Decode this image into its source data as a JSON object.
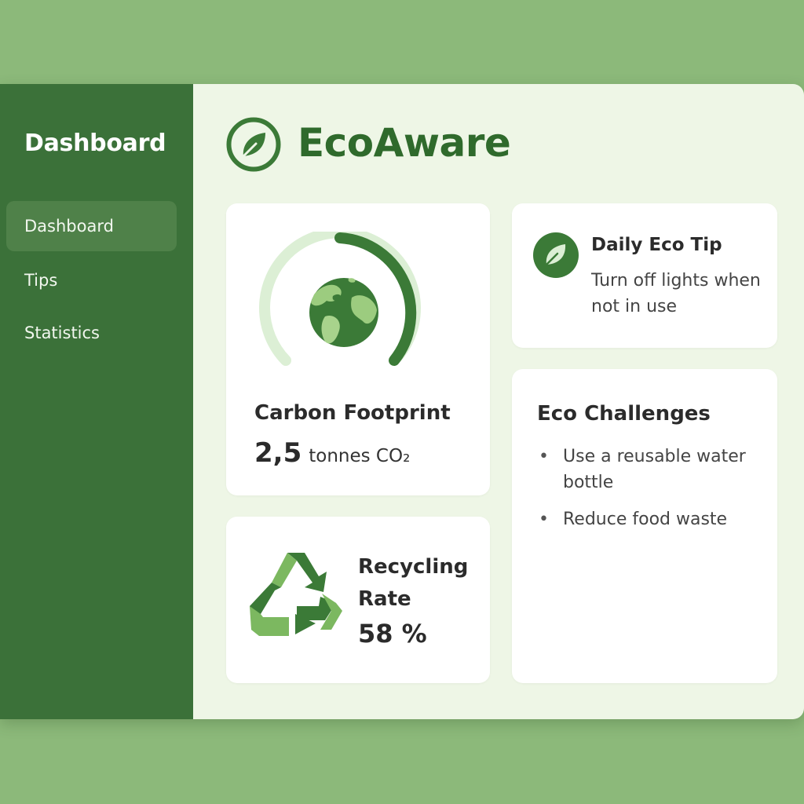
{
  "sidebar": {
    "title": "Dashboard",
    "items": [
      {
        "label": "Dashboard",
        "active": true
      },
      {
        "label": "Tips",
        "active": false
      },
      {
        "label": "Statistics",
        "active": false
      }
    ]
  },
  "app": {
    "title": "EcoAware",
    "logo_icon": "leaf-circle-icon"
  },
  "carbon": {
    "label": "Carbon Footprint",
    "value": "2,5",
    "unit": "tonnes CO₂",
    "icon": "globe-icon"
  },
  "recycling": {
    "label": "Recycling Rate",
    "value": "58 %",
    "icon": "recycle-icon"
  },
  "tip": {
    "title": "Daily Eco Tip",
    "text": "Turn off lights when not in use",
    "icon": "leaf-icon"
  },
  "challenges": {
    "title": "Eco Challenges",
    "items": [
      "Use a reusable water bottle",
      "Reduce food waste"
    ]
  },
  "colors": {
    "page_background": "#8cb97a",
    "sidebar": "#3b7139",
    "sidebar_active": "#4f8149",
    "accent": "#3b7a37",
    "accent_light": "#dcefd5",
    "content_background": "#eef6e6"
  }
}
